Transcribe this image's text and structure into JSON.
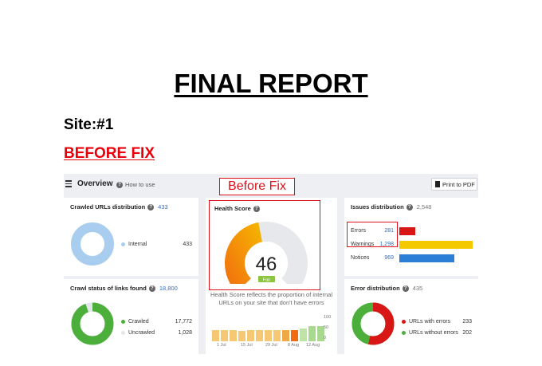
{
  "report": {
    "title": "FINAL REPORT",
    "site": "Site:#1",
    "before_fix": "BEFORE FIX"
  },
  "toolbar": {
    "menu_icon": "hamburger-icon",
    "title": "Overview",
    "how_to_use": "How to use",
    "print_label": "Print to PDF"
  },
  "annotation": {
    "before_fix_callout": "Before Fix"
  },
  "crawled_urls": {
    "title": "Crawled URLs distribution",
    "count": "433",
    "legend": [
      {
        "label": "Internal",
        "value": "433",
        "color": "#a9cdee"
      }
    ]
  },
  "health_score": {
    "title": "Health Score",
    "score": "46",
    "status": "Fair",
    "value": 46,
    "description_line1": "Health Score reflects the proportion of internal",
    "description_line2": "URLs on your site that don't have errors",
    "history": {
      "y_ticks": [
        "100",
        "50",
        "0"
      ],
      "x_labels": [
        "1 Jul",
        "15 Jul",
        "29 Jul",
        "8 Aug",
        "12 Aug"
      ],
      "values": [
        46,
        46,
        46,
        45,
        46,
        46,
        46,
        47,
        46,
        47,
        55,
        65,
        65
      ],
      "ylim": [
        0,
        100
      ]
    }
  },
  "issues": {
    "title": "Issues distribution",
    "count": "2,548",
    "rows": [
      {
        "label": "Errors",
        "value": "281",
        "fraction": 0.217,
        "color": "#d81616"
      },
      {
        "label": "Warnings",
        "value": "1,298",
        "fraction": 1.0,
        "color": "#f5c900"
      },
      {
        "label": "Notices",
        "value": "969",
        "fraction": 0.747,
        "color": "#2b7fd6"
      }
    ]
  },
  "crawl_status": {
    "title": "Crawl status of links found",
    "count": "18,800",
    "legend": [
      {
        "label": "Crawled",
        "value": "17,772",
        "color": "#4caf3c"
      },
      {
        "label": "Uncrawled",
        "value": "1,028",
        "color": "#e3e6ea"
      }
    ]
  },
  "error_distribution": {
    "title": "Error distribution",
    "count": "435",
    "legend": [
      {
        "label": "URLs with errors",
        "value": "233",
        "color": "#d81616"
      },
      {
        "label": "URLs without errors",
        "value": "202",
        "color": "#4caf3c"
      }
    ]
  },
  "colors": {
    "accent_red": "#e0101a",
    "link_blue": "#2b6fd6",
    "gauge_orange": "#f28c0f",
    "gauge_grey": "#e6e8ec",
    "fair_badge": "#8cc63f"
  }
}
